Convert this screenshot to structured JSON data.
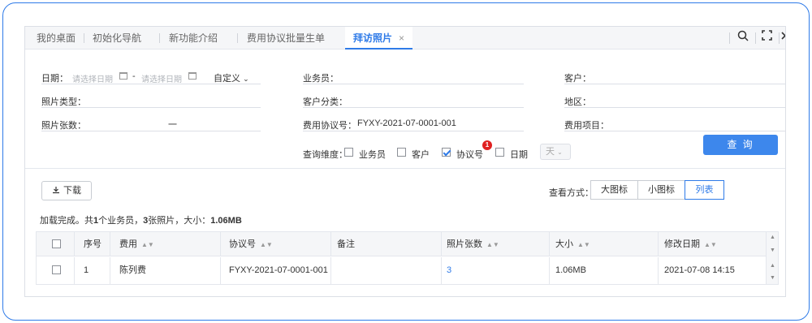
{
  "tabs": [
    {
      "label": "我的桌面"
    },
    {
      "label": "初始化导航"
    },
    {
      "label": "新功能介绍"
    },
    {
      "label": "费用协议批量生单"
    },
    {
      "label": "拜访照片",
      "close": "×"
    }
  ],
  "toolbar_icons": [
    "search-icon",
    "fullscreen-icon",
    "close-icon"
  ],
  "filters": {
    "date_label": "日期：",
    "date_start_placeholder": "请选择日期",
    "date_sep": "-",
    "date_end_placeholder": "请选择日期",
    "date_mode": "自定义",
    "salesman_label": "业务员：",
    "customer_label": "客户：",
    "photo_type_label": "照片类型：",
    "customer_category_label": "客户分类：",
    "region_label": "地区：",
    "photo_count_label": "照片张数：",
    "photo_count_value": "一",
    "agreement_label": "费用协议号：",
    "agreement_value": "FYXY-2021-07-0001-001",
    "expense_item_label": "费用项目：",
    "dimension_label": "查询维度：",
    "dimensions": [
      {
        "label": "业务员",
        "checked": false
      },
      {
        "label": "客户",
        "checked": false
      },
      {
        "label": "协议号",
        "checked": true,
        "badge": "1"
      },
      {
        "label": "日期",
        "checked": false
      }
    ],
    "unit_select": "天",
    "query_button": "查 询"
  },
  "actions": {
    "download_label": "下载",
    "view_label": "查看方式：",
    "view_options": [
      "大图标",
      "小图标",
      "列表"
    ],
    "view_selected": "列表"
  },
  "summary": {
    "prefix": "加载完成。共",
    "salesman_count": "1",
    "mid1": "个业务员，",
    "photo_count": "3",
    "mid2": "张照片，大小：",
    "size": "1.06MB"
  },
  "table": {
    "columns": [
      "序号",
      "费用",
      "协议号",
      "备注",
      "照片张数",
      "大小",
      "修改日期"
    ],
    "rows": [
      {
        "index": "1",
        "expense": "陈列费",
        "agreement": "FYXY-2021-07-0001-001",
        "remark": "",
        "photos": "3",
        "size": "1.06MB",
        "modified": "2021-07-08 14:15"
      }
    ]
  },
  "colors": {
    "accent": "#2f7be8",
    "primary_button": "#3d87ec",
    "badge": "#e02020"
  }
}
